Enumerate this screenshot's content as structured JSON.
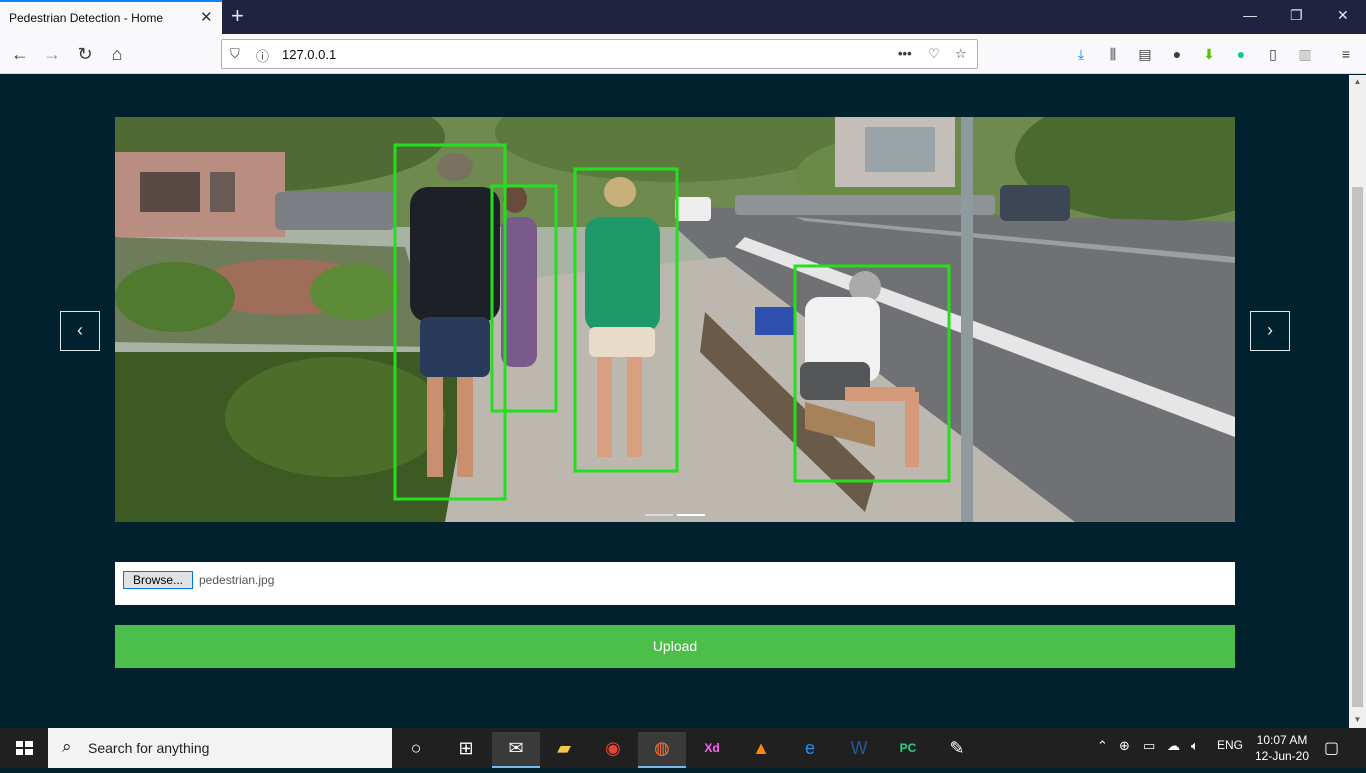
{
  "browser": {
    "tab_title": "Pedestrian Detection - Home",
    "url": "127.0.0.1",
    "page_actions_icon": "more-icon"
  },
  "page": {
    "carousel": {
      "prev_label": "‹",
      "next_label": "›",
      "detections": 4
    },
    "form": {
      "browse_label": "Browse...",
      "file_name": "pedestrian.jpg",
      "upload_label": "Upload"
    }
  },
  "taskbar": {
    "search_placeholder": "Search for anything",
    "language": "ENG",
    "time": "10:07 AM",
    "date": "12-Jun-20"
  },
  "colors": {
    "page_bg": "#02212f",
    "accent_green": "#4cbf4b",
    "detection_box": "#22e01e"
  }
}
